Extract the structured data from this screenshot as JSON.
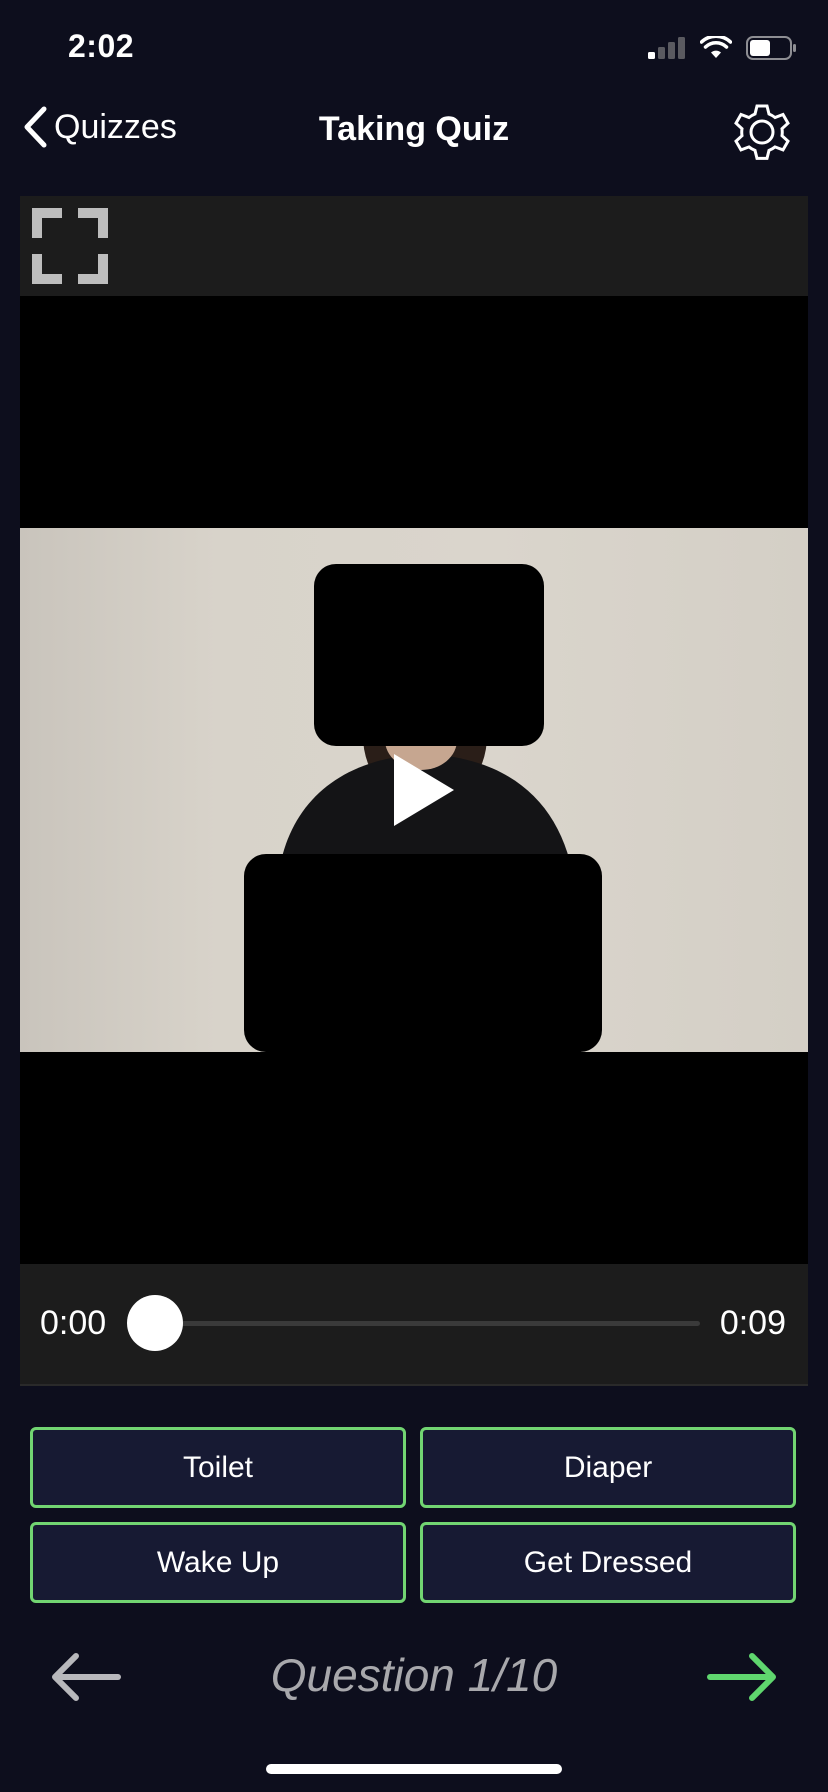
{
  "status_bar": {
    "time": "2:02",
    "icons": [
      "cellular-signal-icon",
      "wifi-icon",
      "battery-icon"
    ]
  },
  "nav": {
    "back_label": "Quizzes",
    "title": "Taking Quiz",
    "settings_icon": "gear-icon"
  },
  "player": {
    "current_time": "0:00",
    "total_time": "0:09",
    "progress": 0,
    "fullscreen_icon": "fullscreen-icon",
    "play_icon": "play-icon"
  },
  "answers": [
    {
      "label": "Toilet"
    },
    {
      "label": "Diaper"
    },
    {
      "label": "Wake Up"
    },
    {
      "label": "Get Dressed"
    }
  ],
  "footer": {
    "question_counter": "Question 1/10",
    "prev_icon": "arrow-left-icon",
    "next_icon": "arrow-right-icon"
  },
  "colors": {
    "background": "#0d0e1d",
    "answer_border": "#72d572",
    "answer_fill": "#171a33",
    "next_arrow": "#5fd66e",
    "prev_arrow": "#b8b8bc"
  }
}
